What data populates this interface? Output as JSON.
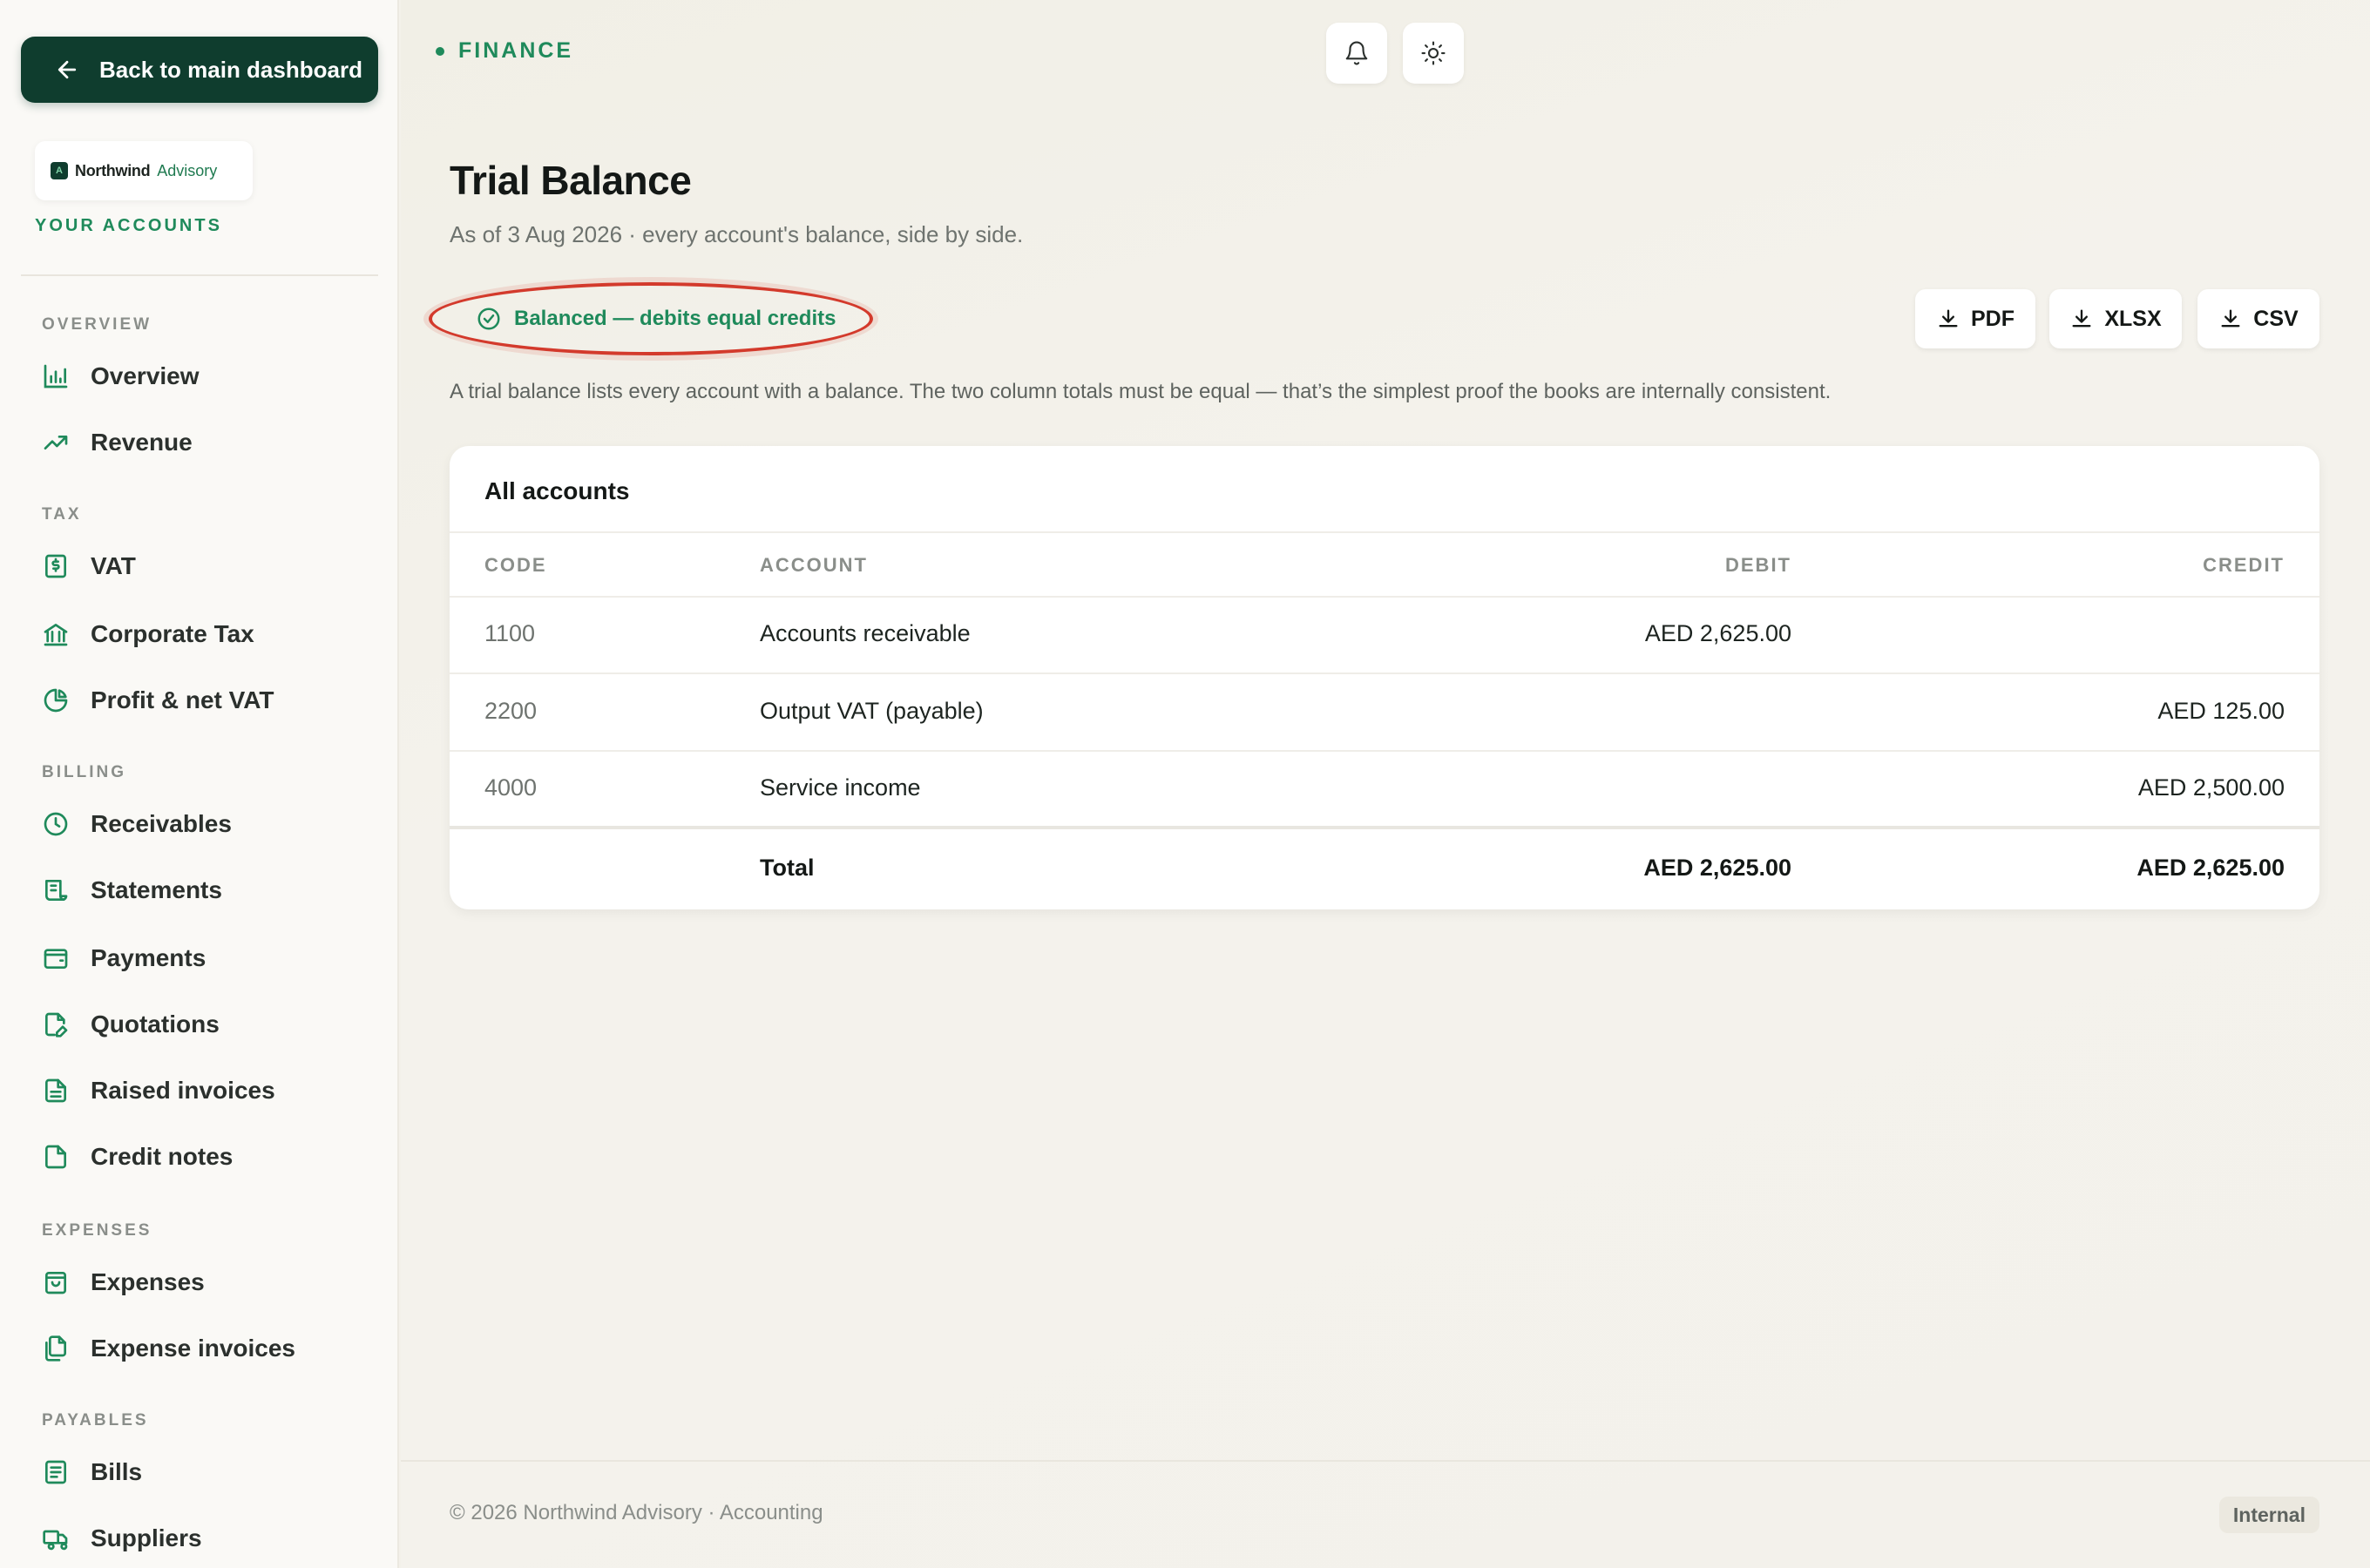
{
  "sidebar": {
    "back_label": "Back to main dashboard",
    "brand": {
      "name": "Northwind",
      "sub": "Advisory",
      "mark": "A"
    },
    "your_accounts": "YOUR ACCOUNTS",
    "sections": {
      "overview": "OVERVIEW",
      "tax": "TAX",
      "billing": "BILLING",
      "expenses": "EXPENSES",
      "payables": "PAYABLES"
    },
    "items": {
      "overview": "Overview",
      "revenue": "Revenue",
      "vat": "VAT",
      "corporate_tax": "Corporate Tax",
      "profit_net_vat": "Profit & net VAT",
      "receivables": "Receivables",
      "statements": "Statements",
      "payments": "Payments",
      "quotations": "Quotations",
      "raised_invoices": "Raised invoices",
      "credit_notes": "Credit notes",
      "expenses": "Expenses",
      "expense_invoices": "Expense invoices",
      "bills": "Bills",
      "suppliers": "Suppliers"
    }
  },
  "header": {
    "breadcrumb": "FINANCE",
    "title": "Trial Balance",
    "subtitle": "As of 3 Aug 2026 · every account's balance, side by side."
  },
  "status": {
    "balanced_label": "Balanced — debits equal credits"
  },
  "exports": {
    "pdf": "PDF",
    "xlsx": "XLSX",
    "csv": "CSV"
  },
  "explanation": "A trial balance lists every account with a balance. The two column totals must be equal — that’s the simplest proof the books are internally consistent.",
  "table": {
    "title": "All accounts",
    "columns": {
      "code": "CODE",
      "account": "ACCOUNT",
      "debit": "DEBIT",
      "credit": "CREDIT"
    },
    "rows": [
      {
        "code": "1100",
        "account": "Accounts receivable",
        "debit": "AED 2,625.00",
        "credit": ""
      },
      {
        "code": "2200",
        "account": "Output VAT (payable)",
        "debit": "",
        "credit": "AED 125.00"
      },
      {
        "code": "4000",
        "account": "Service income",
        "debit": "",
        "credit": "AED 2,500.00"
      }
    ],
    "total": {
      "label": "Total",
      "debit": "AED 2,625.00",
      "credit": "AED 2,625.00"
    }
  },
  "footer": {
    "copyright": "© 2026 Northwind Advisory · Accounting",
    "badge": "Internal"
  },
  "colors": {
    "accent": "#1f8a5b",
    "brand_dark": "#0f3d2e",
    "highlight_ring": "#d33a2c"
  }
}
